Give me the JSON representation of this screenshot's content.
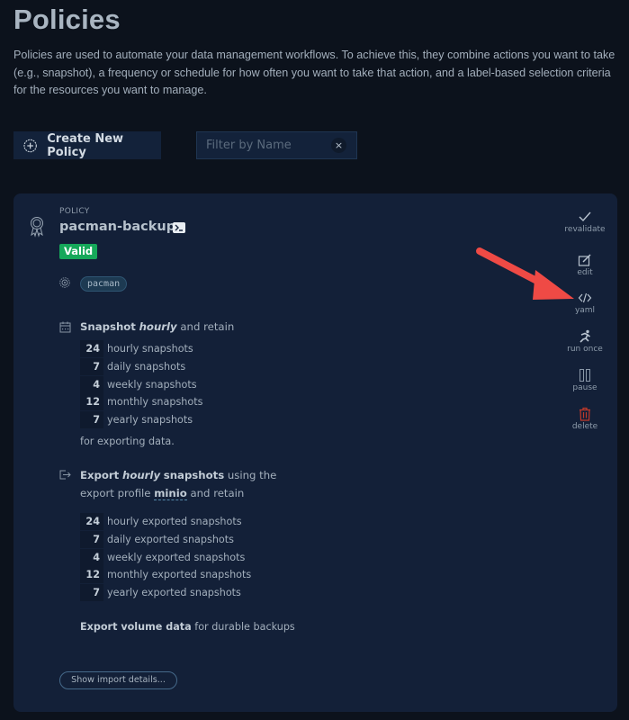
{
  "page": {
    "title": "Policies",
    "description": "Policies are used to automate your data management workflows. To achieve this, they combine actions you want to take (e.g., snapshot), a frequency or schedule for how often you want to take that action, and a label-based selection criteria for the resources you want to manage."
  },
  "toolbar": {
    "create_label": "Create New Policy",
    "filter_placeholder": "Filter by Name",
    "filter_value": "",
    "clear_icon": "×"
  },
  "policy": {
    "kind_label": "POLICY",
    "name": "pacman-backup",
    "status": "Valid",
    "status_color": "#16a85a",
    "selector_label": "pacman",
    "snapshot": {
      "head_bold": "Snapshot",
      "head_freq": "hourly",
      "head_tail": "and retain",
      "retention": [
        {
          "count": "24",
          "text": "hourly snapshots"
        },
        {
          "count": "7",
          "text": "daily snapshots"
        },
        {
          "count": "4",
          "text": "weekly snapshots"
        },
        {
          "count": "12",
          "text": "monthly snapshots"
        },
        {
          "count": "7",
          "text": "yearly snapshots"
        }
      ],
      "footer": "for exporting data."
    },
    "export": {
      "head_bold1": "Export",
      "head_freq": "hourly",
      "head_bold2": "snapshots",
      "head_mid": "using the",
      "head_line2_pre": "export profile",
      "profile": "minio",
      "head_line2_post": "and retain",
      "retention": [
        {
          "count": "24",
          "text": "hourly exported snapshots"
        },
        {
          "count": "7",
          "text": "daily exported snapshots"
        },
        {
          "count": "4",
          "text": "weekly exported snapshots"
        },
        {
          "count": "12",
          "text": "monthly exported snapshots"
        },
        {
          "count": "7",
          "text": "yearly exported snapshots"
        }
      ],
      "volume_bold": "Export volume data",
      "volume_tail": "for durable backups"
    },
    "import_button": "Show import details..."
  },
  "actions": [
    {
      "label": "revalidate",
      "icon": "check-icon"
    },
    {
      "label": "edit",
      "icon": "edit-icon"
    },
    {
      "label": "yaml",
      "icon": "code-icon"
    },
    {
      "label": "run once",
      "icon": "run-icon"
    },
    {
      "label": "pause",
      "icon": "pause-icon"
    },
    {
      "label": "delete",
      "icon": "trash-icon"
    }
  ],
  "colors": {
    "background": "#0c121c",
    "card": "#132038",
    "delete": "#c0392b",
    "annotation_arrow": "#ef4a45"
  }
}
